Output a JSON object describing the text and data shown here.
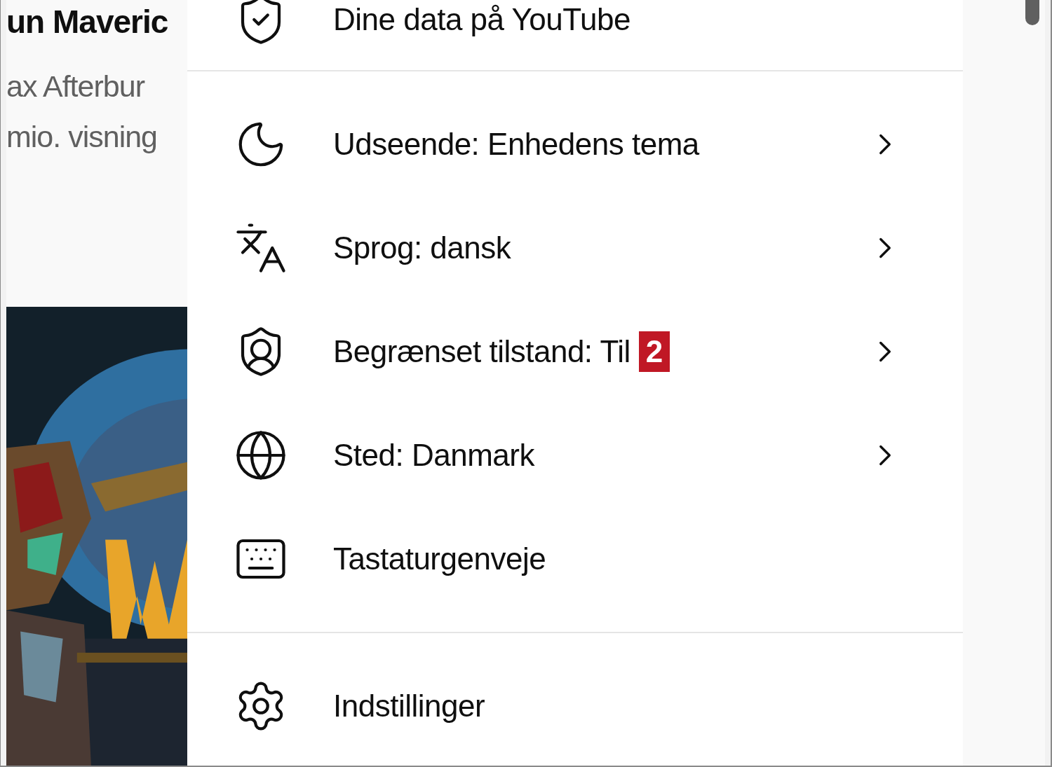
{
  "video": {
    "title": "un Maveric",
    "channel": "ax Afterbur",
    "views": "mio. visning"
  },
  "menu": {
    "sections": [
      {
        "items": [
          {
            "kind": "data",
            "label": "Dine data på YouTube",
            "submenu": false
          }
        ]
      },
      {
        "items": [
          {
            "kind": "appearance",
            "label": "Udseende: Enhedens tema",
            "submenu": true
          },
          {
            "kind": "language",
            "label": "Sprog: dansk",
            "submenu": true
          },
          {
            "kind": "restricted",
            "label": "Begrænset tilstand: Til",
            "submenu": true,
            "badge": "2"
          },
          {
            "kind": "location",
            "label": "Sted: Danmark",
            "submenu": true
          },
          {
            "kind": "keyboard",
            "label": "Tastaturgenveje",
            "submenu": false
          }
        ]
      },
      {
        "items": [
          {
            "kind": "settings",
            "label": "Indstillinger",
            "submenu": false
          }
        ]
      }
    ]
  }
}
